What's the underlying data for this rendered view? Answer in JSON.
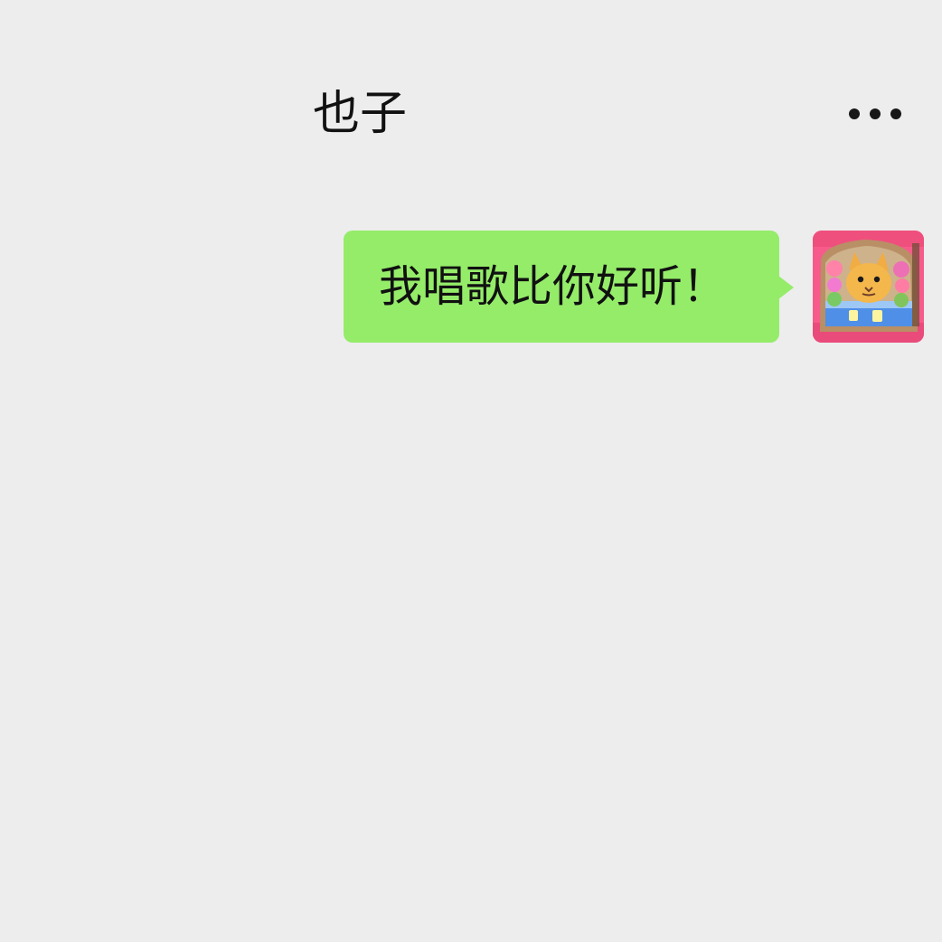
{
  "header": {
    "title": "也子",
    "more_icon": "more-horizontal-icon"
  },
  "messages": [
    {
      "direction": "outgoing",
      "text": "我唱歌比你好听！",
      "avatar_icon": "cat-toast-avatar"
    }
  ],
  "colors": {
    "background": "#ededed",
    "bubble_outgoing": "#95ec69",
    "text": "#111111"
  }
}
